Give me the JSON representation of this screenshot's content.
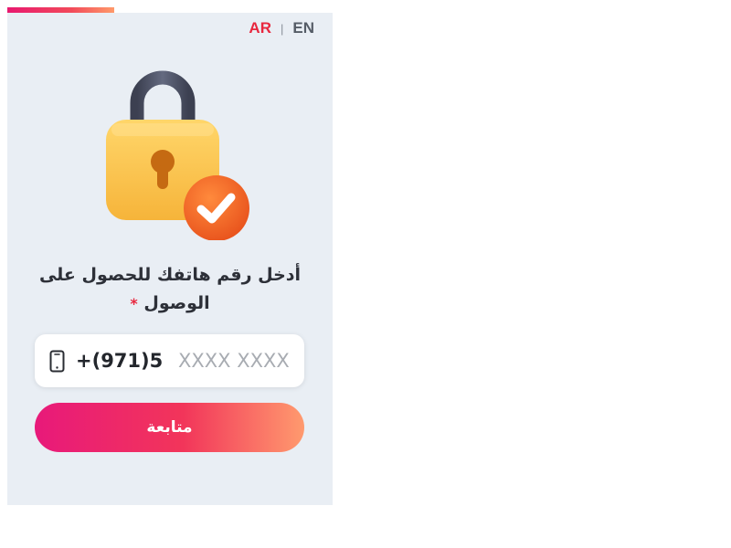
{
  "progress": {
    "fraction": 0.33,
    "color": "#e8196f"
  },
  "language": {
    "ar_label": "AR",
    "separator": "|",
    "en_label": "EN",
    "active": "AR",
    "active_color": "#e8273e"
  },
  "illustration": {
    "icon": "lock-with-checkmark-icon"
  },
  "heading": {
    "text": "أدخل رقم هاتفك للحصول على الوصول",
    "required_mark": "*"
  },
  "phone": {
    "icon": "mobile-phone-icon",
    "prefix": "+(971)5",
    "value": "",
    "placeholder": "XXXX XXXX"
  },
  "continue_button": {
    "label": "متابعة"
  }
}
